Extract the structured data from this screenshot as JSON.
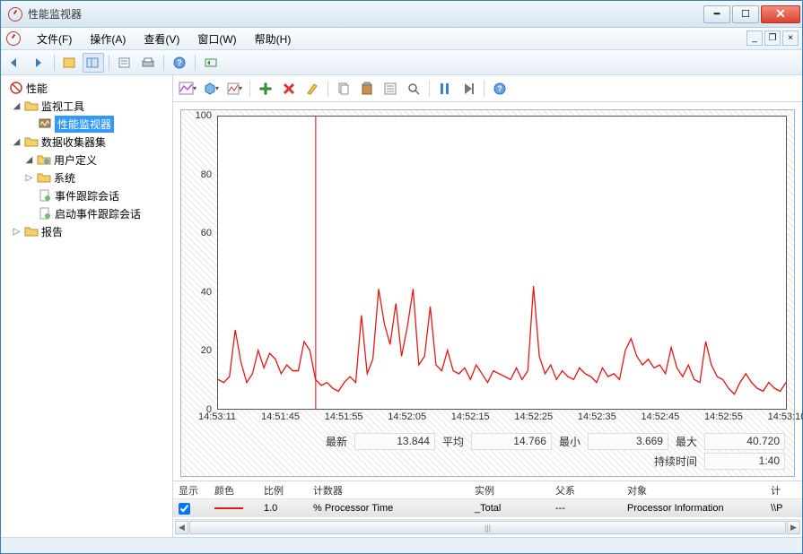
{
  "title": "性能监视器",
  "menu": {
    "file": "文件(F)",
    "action": "操作(A)",
    "view": "查看(V)",
    "window": "窗口(W)",
    "help": "帮助(H)"
  },
  "tree": {
    "root": "性能",
    "monitor_tools": "监视工具",
    "perfmon": "性能监视器",
    "collector_sets": "数据收集器集",
    "user_defined": "用户定义",
    "system": "系统",
    "event_trace": "事件跟踪会话",
    "startup_trace": "启动事件跟踪会话",
    "reports": "报告"
  },
  "stats": {
    "latest_lab": "最新",
    "latest_val": "13.844",
    "avg_lab": "平均",
    "avg_val": "14.766",
    "min_lab": "最小",
    "min_val": "3.669",
    "max_lab": "最大",
    "max_val": "40.720",
    "dur_lab": "持续时间",
    "dur_val": "1:40"
  },
  "counters": {
    "h_show": "显示",
    "h_color": "颜色",
    "h_scale": "比例",
    "h_counter": "计数器",
    "h_instance": "实例",
    "h_parent": "父系",
    "h_object": "对象",
    "h_computer": "计",
    "row": {
      "scale": "1.0",
      "counter": "% Processor Time",
      "instance": "_Total",
      "parent": "---",
      "object": "Processor Information",
      "computer": "\\\\P"
    }
  },
  "chart_data": {
    "type": "line",
    "ylim": [
      0,
      100
    ],
    "yticks": [
      0,
      20,
      40,
      60,
      80,
      100
    ],
    "xticks": [
      "14:53:11",
      "14:51:45",
      "14:51:55",
      "14:52:05",
      "14:52:15",
      "14:52:25",
      "14:52:35",
      "14:52:45",
      "14:52:55",
      "14:53:10"
    ],
    "cursor_x_frac": 0.172,
    "series": [
      {
        "name": "% Processor Time",
        "color": "#e81313",
        "values": [
          10,
          9,
          11,
          27,
          16,
          9,
          12,
          20,
          14,
          19,
          17,
          12,
          15,
          13,
          13,
          23,
          20,
          10,
          8,
          9,
          7,
          6,
          9,
          11,
          9,
          32,
          12,
          17,
          41,
          29,
          22,
          36,
          18,
          28,
          41,
          15,
          18,
          35,
          15,
          13,
          20,
          13,
          12,
          14,
          10,
          15,
          12,
          9,
          13,
          12,
          11,
          10,
          14,
          10,
          13,
          42,
          18,
          12,
          15,
          10,
          13,
          11,
          10,
          14,
          12,
          11,
          9,
          14,
          11,
          12,
          10,
          20,
          24,
          18,
          15,
          17,
          14,
          15,
          12,
          21,
          14,
          11,
          15,
          10,
          9,
          23,
          15,
          11,
          10,
          7,
          5,
          9,
          12,
          9,
          7,
          6,
          9,
          7,
          6,
          9
        ]
      }
    ]
  }
}
